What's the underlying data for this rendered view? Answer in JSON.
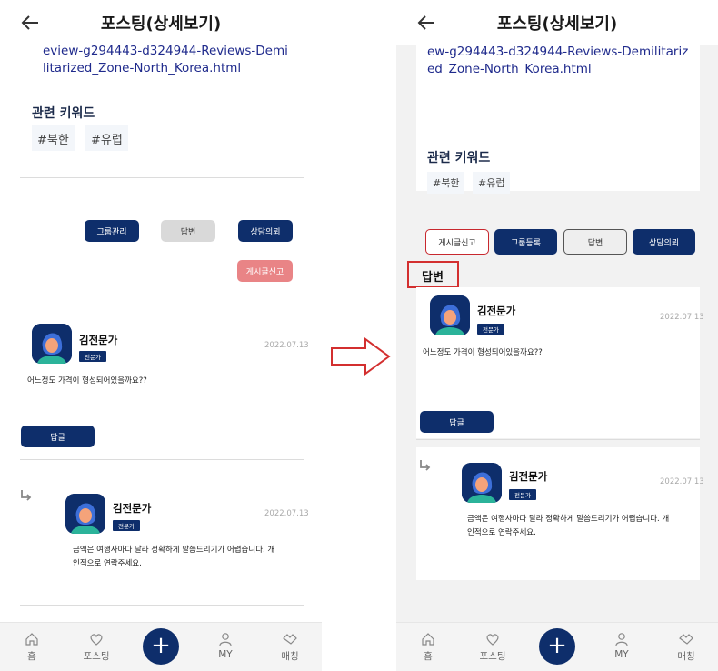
{
  "header": {
    "title": "포스팅(상세보기)"
  },
  "left": {
    "link_text": "eview-g294443-d324944-Reviews-Demilitarized_Zone-North_Korea.html",
    "keywords_title": "관련 키워드",
    "tags": [
      "#북한",
      "#유럽"
    ],
    "buttons": {
      "group_manage": "그룹관리",
      "answer": "답변",
      "consult": "상담의뢰",
      "report": "게시글신고"
    },
    "answer": {
      "name": "김전문가",
      "badge": "전문가",
      "date": "2022.07.13",
      "text": "어느정도 가격이 형성되어있을까요??",
      "reply_button": "답글"
    },
    "reply": {
      "name": "김전문가",
      "badge": "전문가",
      "date": "2022.07.13",
      "text_line1": "금액은 여행사마다 달라 정확하게 말씀드리기가 어렵습니다. 개",
      "text_line2": "인적으로 연락주세요."
    }
  },
  "right": {
    "link_text": "ew-g294443-d324944-Reviews-Demilitarized_Zone-North_Korea.html",
    "keywords_title": "관련 키워드",
    "tags": [
      "#북한",
      "#유럽"
    ],
    "buttons": {
      "report": "게시글신고",
      "group_register": "그룹등록",
      "answer": "답변",
      "consult": "상담의뢰"
    },
    "section_label": "답변",
    "answer": {
      "name": "김전문가",
      "badge": "전문가",
      "date": "2022.07.13",
      "text": "어느정도 가격이 형성되어있을까요??",
      "reply_button": "답글"
    },
    "reply": {
      "name": "김전문가",
      "badge": "전문가",
      "date": "2022.07.13",
      "text_line1": "금액은 여행사마다 달라 정확하게 말씀드리기가 어렵습니다. 개",
      "text_line2": "인적으로 연락주세요."
    }
  },
  "tabbar": {
    "home": "홈",
    "posting": "포스팅",
    "plus": "+",
    "my": "MY",
    "matching": "매칭"
  },
  "colors": {
    "navy": "#0e2e6b",
    "report_pink": "#e98486",
    "highlight_red": "#d32f2f"
  }
}
